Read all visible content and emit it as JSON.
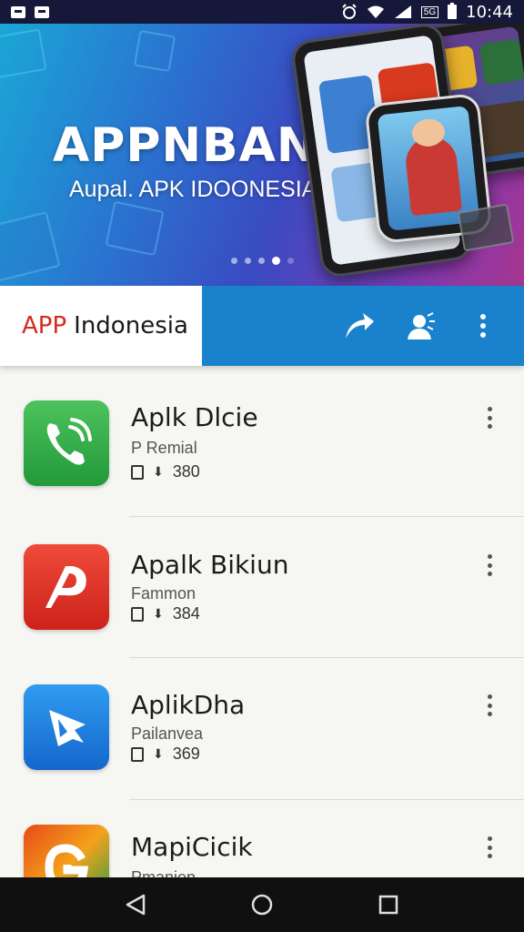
{
  "status_bar": {
    "time": "10:44",
    "network_label": "5G",
    "icons": [
      "notification-icon",
      "notification-icon",
      "alarm-icon",
      "wifi-icon",
      "signal-icon",
      "battery-icon"
    ]
  },
  "banner": {
    "title": "APPNBANIT",
    "subtitle": "Aupal. APK IDOONESIA",
    "pager_count": 5,
    "pager_active": 3
  },
  "header": {
    "brand_prefix": "APP",
    "brand_name": "Indonesia",
    "actions": [
      "share-icon",
      "profile-icon",
      "more-icon"
    ],
    "colors": {
      "brand_red": "#d32a1e",
      "header_blue": "#1a82cc"
    }
  },
  "apps": [
    {
      "name": "Aplk Dlcie",
      "subtitle": "P Remial",
      "count": "380",
      "icon": "phone-icon",
      "icon_color": "#2fb14a"
    },
    {
      "name": "Apalk Bikiun",
      "subtitle": "Fammon",
      "count": "384",
      "icon": "pdf-reader-icon",
      "icon_color": "#e2332a"
    },
    {
      "name": "AplikDha",
      "subtitle": "Pailanvea",
      "count": "369",
      "icon": "play-arrow-icon",
      "icon_color": "#1e7fe0"
    },
    {
      "name": "MapiCicik",
      "subtitle": "Pmanjen",
      "count": "",
      "icon": "google-g-icon",
      "icon_color": "#e64a19"
    }
  ],
  "nav": [
    "back-icon",
    "home-icon",
    "recents-icon"
  ]
}
